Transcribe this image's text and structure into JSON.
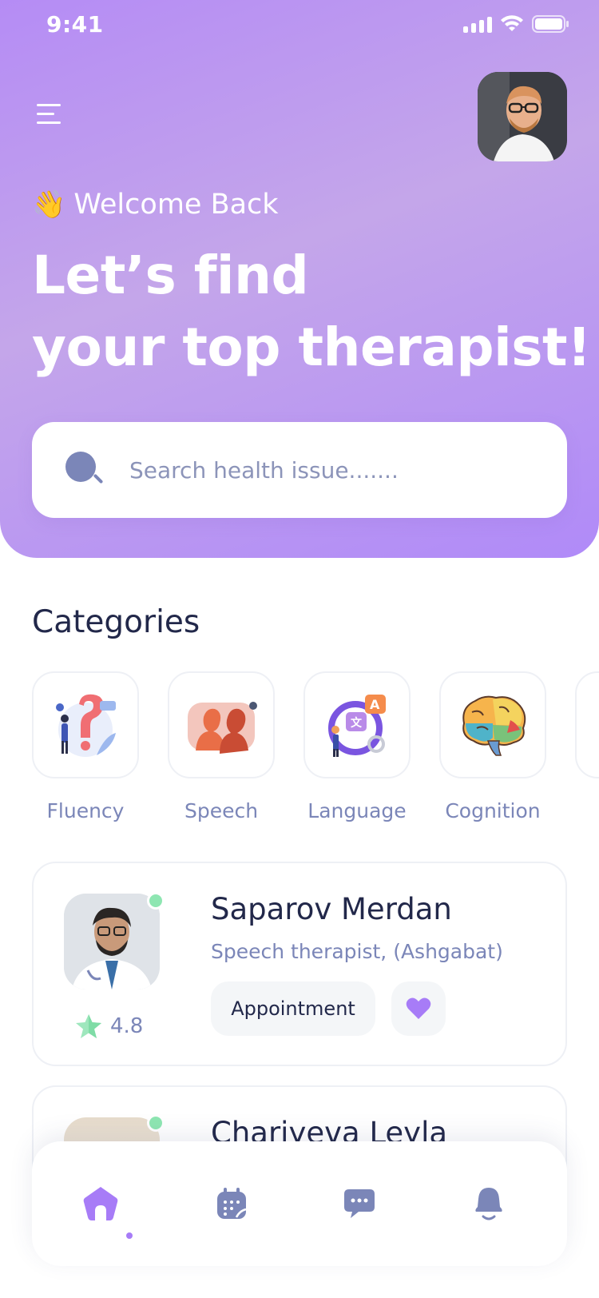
{
  "status_bar": {
    "time": "9:41"
  },
  "header": {
    "welcome_emoji": "👋",
    "welcome_text": "Welcome Back",
    "headline_line1": "Let’s find",
    "headline_line2": "your top therapist!"
  },
  "search": {
    "placeholder": "Search health issue......."
  },
  "categories": {
    "title": "Categories",
    "items": [
      {
        "label": "Fluency",
        "icon": "fluency-icon"
      },
      {
        "label": "Speech",
        "icon": "speech-icon"
      },
      {
        "label": "Language",
        "icon": "language-icon"
      },
      {
        "label": "Cognition",
        "icon": "cognition-icon"
      }
    ]
  },
  "therapists": [
    {
      "name": "Saparov Merdan",
      "role": "Speech therapist, (Ashgabat)",
      "rating": "4.8",
      "appointment_label": "Appointment",
      "online": true
    },
    {
      "name": "Chariyeva Leyla",
      "online": true
    }
  ],
  "bottom_nav": {
    "items": [
      "home-icon",
      "calendar-icon",
      "chat-icon",
      "bell-icon"
    ],
    "active": "home-icon"
  },
  "colors": {
    "accent": "#a77cf7",
    "text_primary": "#22284a",
    "text_secondary": "#7b86b8",
    "online": "#8ee6b2"
  }
}
